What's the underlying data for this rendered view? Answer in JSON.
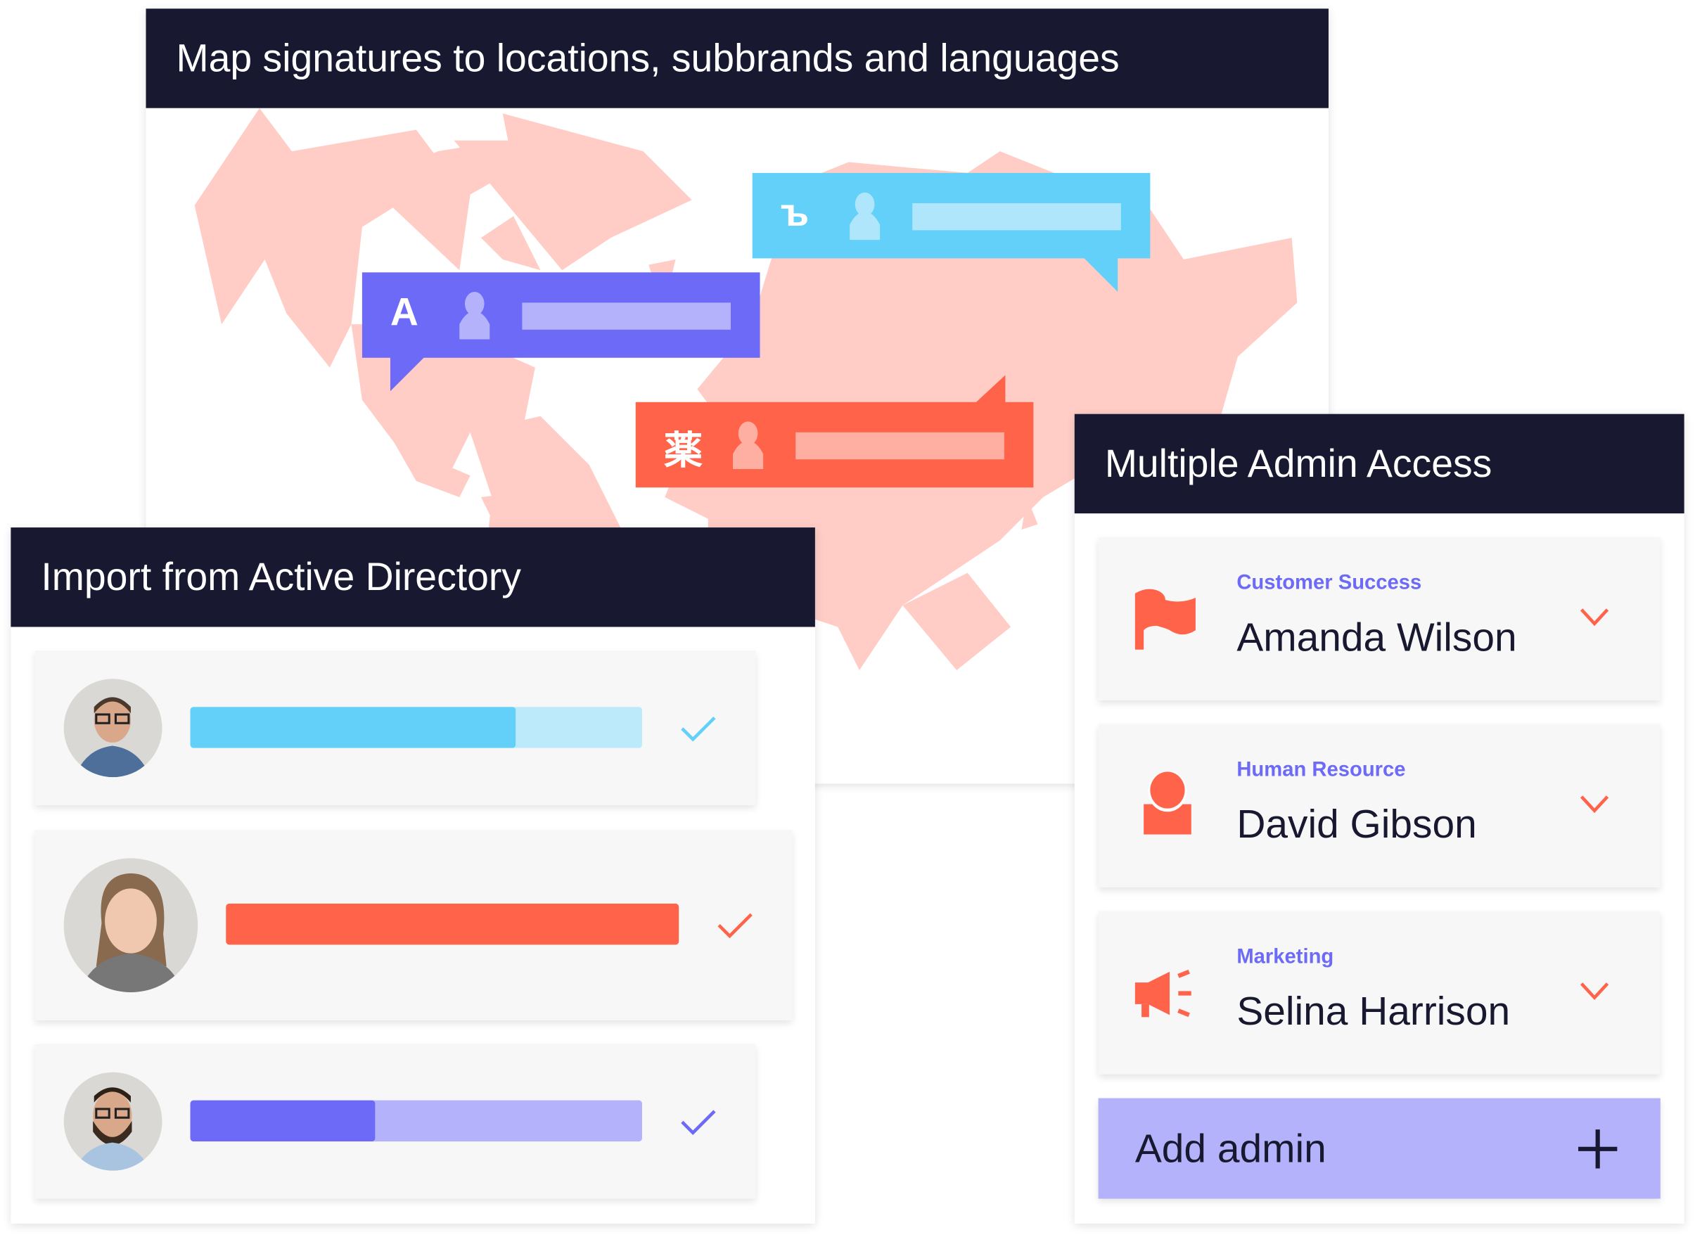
{
  "map_card": {
    "title": "Map signatures to locations, subbrands and languages",
    "bubbles": [
      {
        "glyph": "ъ",
        "color": "#62d0f8",
        "line_color": "#b0e6fb"
      },
      {
        "glyph": "A",
        "color": "#6c6af6",
        "line_color": "#b3b2fa"
      },
      {
        "glyph": "薬",
        "color": "#ff634a",
        "line_color": "#ffafa2"
      }
    ],
    "map_color": "#ffcdc6"
  },
  "import_card": {
    "title": "Import from Active Directory",
    "rows": [
      {
        "progress": 0.72,
        "color": "#62d0f8",
        "track": "#bdeafa",
        "check": "check-icon"
      },
      {
        "progress": 1.0,
        "color": "#ff634a",
        "track": "#ffafa2",
        "check": "check-icon"
      },
      {
        "progress": 0.41,
        "color": "#6c6af6",
        "track": "#b3b2fa",
        "check": "check-icon"
      }
    ]
  },
  "admin_card": {
    "title": "Multiple Admin Access",
    "admins": [
      {
        "department": "Customer Success",
        "name": "Amanda Wilson",
        "icon": "flag-icon"
      },
      {
        "department": "Human Resource",
        "name": "David Gibson",
        "icon": "person-icon"
      },
      {
        "department": "Marketing",
        "name": "Selina Harrison",
        "icon": "megaphone-icon"
      }
    ],
    "add_label": "Add admin",
    "accent": "#ff634a"
  }
}
